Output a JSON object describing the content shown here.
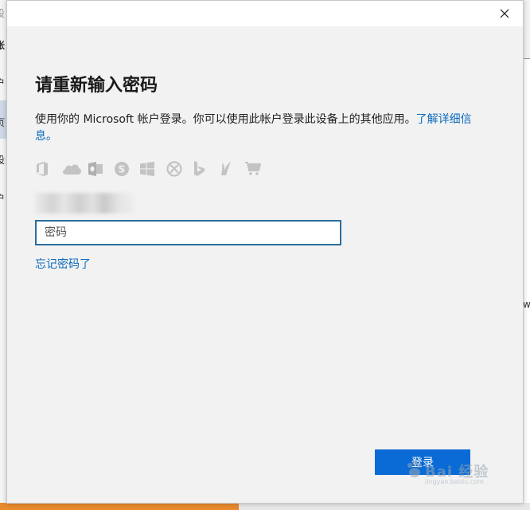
{
  "background": {
    "fragments": [
      "设",
      "帐",
      "户",
      "页",
      "设",
      "户",
      "ji",
      "w"
    ]
  },
  "dialog": {
    "title": "请重新输入密码",
    "description_prefix": "使用你的 Microsoft 帐户登录。你可以使用此帐户登录此设备上的其他应用。",
    "learn_more": "了解详细信息。",
    "service_icons": [
      "office-icon",
      "onedrive-icon",
      "outlook-icon",
      "skype-icon",
      "windows-icon",
      "xbox-icon",
      "bing-icon",
      "msn-icon",
      "store-icon"
    ],
    "password_placeholder": "密码",
    "forgot_password": "忘记密码了",
    "sign_in_label": "登录",
    "close_icon": "close-icon"
  },
  "watermark": {
    "text": "Bai 经验",
    "subtext": "jingyan.baidu.com"
  },
  "colors": {
    "accent": "#0b6bd6",
    "link": "#0b6bbd",
    "field_border": "#2a6d9c",
    "dialog_bg": "#f2f2f2"
  }
}
